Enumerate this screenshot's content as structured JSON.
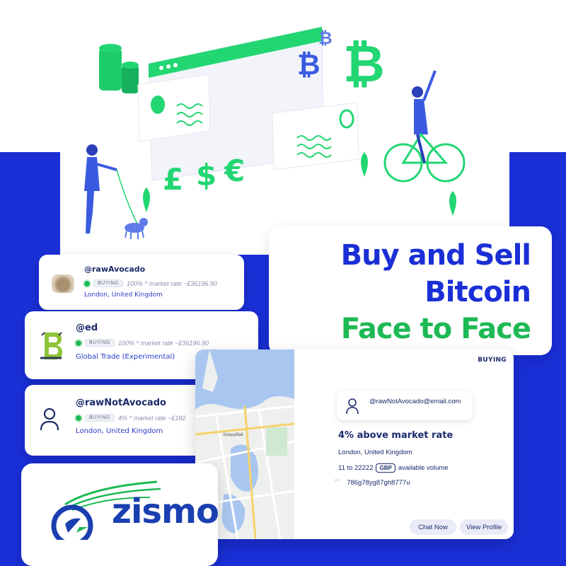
{
  "headline": {
    "line1": "Buy and Sell",
    "line2": "Bitcoin",
    "line3": "Face to Face"
  },
  "illustration": {
    "currency_symbols": [
      "£",
      "$",
      "€"
    ],
    "bitcoin_symbol": "₿"
  },
  "listings": [
    {
      "username": "@rawAvocado",
      "status_badge": "BUYING",
      "rate_text": "100% ^ market rate ~£36196.90",
      "location": "London, United Kingdom",
      "avatar": "photo-avatar"
    },
    {
      "username": "@ed",
      "status_badge": "BUYING",
      "rate_text": "100% ^ market rate ~£36196.90",
      "location": "Global Trade (Experimental)",
      "avatar": "logo-avatar"
    },
    {
      "username": "@rawNotAvocado",
      "status_badge": "BUYING",
      "rate_text": "4% ^ market rate ~£182",
      "location": "London, United Kingdom",
      "avatar": "user-icon"
    }
  ],
  "detail": {
    "tag": "BUYING",
    "email": "@rawNotAvocado@email.com",
    "rate": "4% above market rate",
    "location": "London, United Kingdom",
    "volume_range": "11 to 22222",
    "currency": "GBP",
    "volume_suffix": "available volume",
    "code": "786g78yg87gh8777u",
    "chat_button": "Chat Now",
    "profile_button": "View Profile",
    "map_label": "Қоңырбай"
  },
  "logo": {
    "name": "zismo"
  },
  "colors": {
    "brand_blue": "#1a2fd6",
    "brand_green": "#1db954",
    "text_navy": "#1b2a6b"
  }
}
